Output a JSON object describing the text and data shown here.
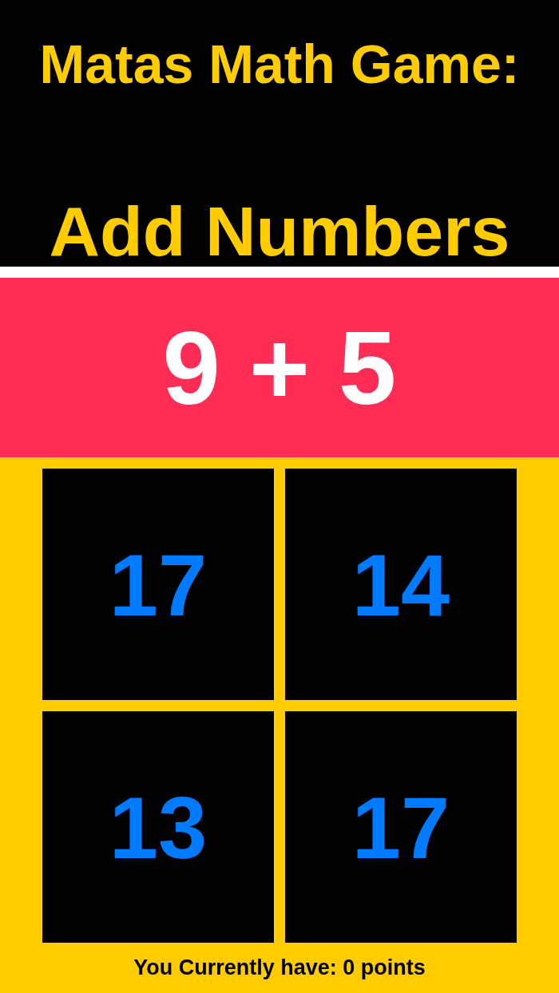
{
  "title": "Matas Math Game:",
  "subtitle": "Add Numbers",
  "question": "9 + 5",
  "answers": [
    {
      "label": "17"
    },
    {
      "label": "14"
    },
    {
      "label": "13"
    },
    {
      "label": "17"
    }
  ],
  "score": "You Currently have: 0 points"
}
